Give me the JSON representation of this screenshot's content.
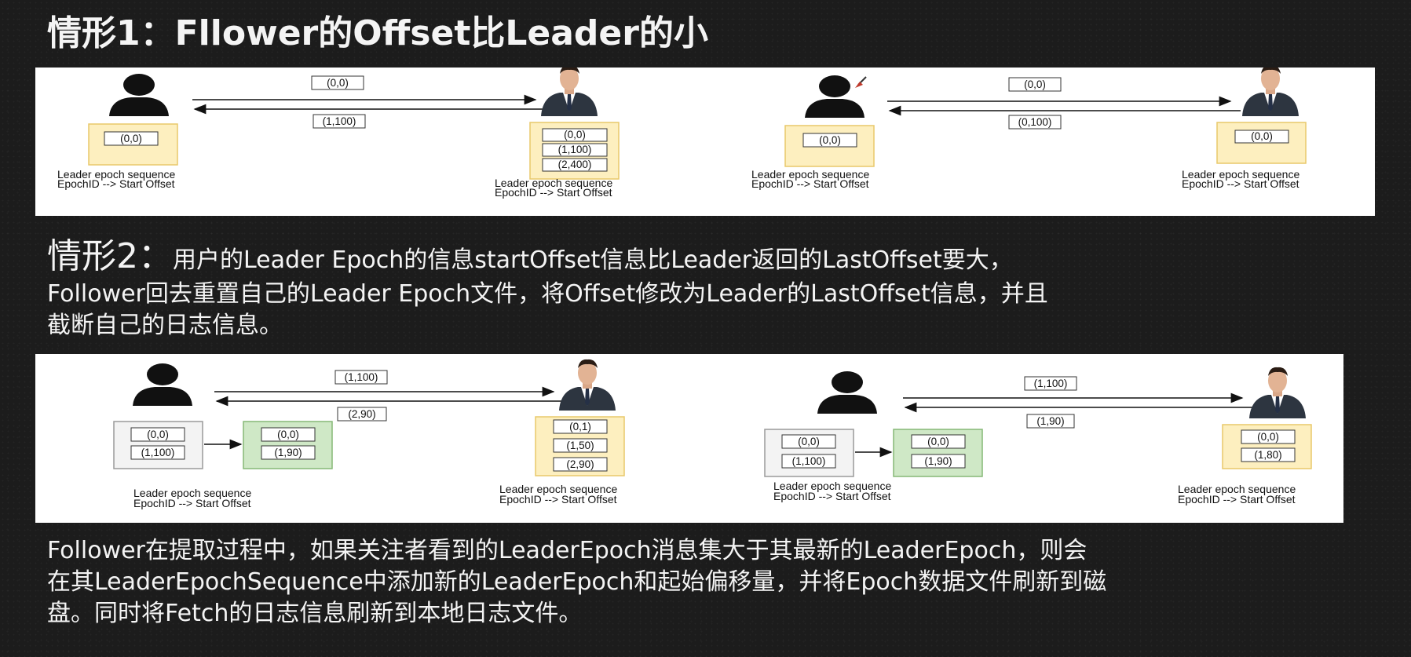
{
  "scenario1": {
    "title": "情形1：Fllower的Offset比Leader的小",
    "caption_line1": "Leader epoch sequence",
    "caption_line2": "EpochID --> Start Offset",
    "left": {
      "request": "(0,0)",
      "response": "(1,100)",
      "follower_entries": [
        "(0,0)"
      ],
      "leader_entries": [
        "(0,0)",
        "(1,100)",
        "(2,400)"
      ]
    },
    "right": {
      "request": "(0,0)",
      "response": "(0,100)",
      "follower_entries": [
        "(0,0)"
      ],
      "leader_entries": [
        "(0,0)"
      ]
    }
  },
  "scenario2": {
    "title_prefix": "情形2：",
    "title_line1": "用户的Leader Epoch的信息startOffset信息比Leader返回的LastOffset要大，",
    "line2": "Follower回去重置自己的Leader Epoch文件，将Offset修改为Leader的LastOffset信息，并且",
    "line3": "截断自己的日志信息。",
    "caption_line1": "Leader epoch sequence",
    "caption_line2": "EpochID --> Start Offset",
    "left": {
      "request": "(1,100)",
      "response": "(2,90)",
      "follower_entries": [
        "(0,0)",
        "(1,100)"
      ],
      "truncated_entries": [
        "(0,0)",
        "(1,90)"
      ],
      "leader_entries": [
        "(0,1)",
        "(1,50)",
        "(2,90)"
      ]
    },
    "right": {
      "request": "(1,100)",
      "response": "(1,90)",
      "follower_entries": [
        "(0,0)",
        "(1,100)"
      ],
      "truncated_entries": [
        "(0,0)",
        "(1,90)"
      ],
      "leader_entries": [
        "(0,0)",
        "(1,80)"
      ]
    }
  },
  "summary": {
    "line1": "Follower在提取过程中，如果关注者看到的LeaderEpoch消息集大于其最新的LeaderEpoch，则会",
    "line2": "在其LeaderEpochSequence中添加新的LeaderEpoch和起始偏移量，并将Epoch数据文件刷新到磁",
    "line3": "盘。同时将Fetch的日志信息刷新到本地日志文件。"
  },
  "colors": {
    "yellow_fill": "#fdefbf",
    "yellow_stroke": "#e8c86a",
    "green_fill": "#cfe8c6",
    "green_stroke": "#86b877",
    "gray_fill": "#f3f3f3",
    "gray_stroke": "#9a9a9a"
  },
  "icons": {
    "follower": "user-silhouette-icon",
    "leader": "businessman-icon",
    "cursor": "pen-cursor-icon"
  }
}
